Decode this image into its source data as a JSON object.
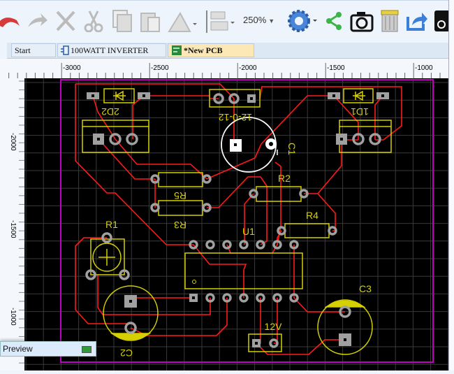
{
  "toolbar": {
    "icons": [
      "undo-icon",
      "redo-icon",
      "cut-icon",
      "scissors-icon",
      "copy-icon",
      "paste-icon",
      "flip-icon",
      "align-icon",
      "settings-gear-icon",
      "share-icon",
      "camera-icon",
      "component-icon",
      "export-icon",
      "tool-icon"
    ],
    "zoom_level": "250%"
  },
  "tabs": [
    {
      "label": "Start",
      "active": false
    },
    {
      "label": "100WATT INVERTER",
      "active": false
    },
    {
      "label": "*New PCB",
      "active": true
    }
  ],
  "rulers": {
    "horizontal": [
      "-3000",
      "-2500",
      "-2000",
      "-1500",
      "-1000"
    ],
    "vertical": [
      "-2000",
      "-1500",
      "-1000"
    ]
  },
  "pcb": {
    "components": {
      "d2": "2D2",
      "d1": "1D1",
      "transformer": "12-0-12",
      "c1": "C1",
      "r5": "R5",
      "r3": "R3",
      "r2": "R2",
      "r4": "R4",
      "u1": "U1",
      "r1": "R1",
      "c2": "C2",
      "c3": "C3",
      "power": "12V"
    },
    "colors": {
      "board_outline": "#c000c0",
      "trace": "#ff1a1a",
      "silkscreen": "#d6d000",
      "pad": "#a0a0a0",
      "selection": "#ffffff",
      "background": "#000000",
      "grid": "#3a3a3a"
    }
  },
  "preview": {
    "label": "Preview"
  }
}
